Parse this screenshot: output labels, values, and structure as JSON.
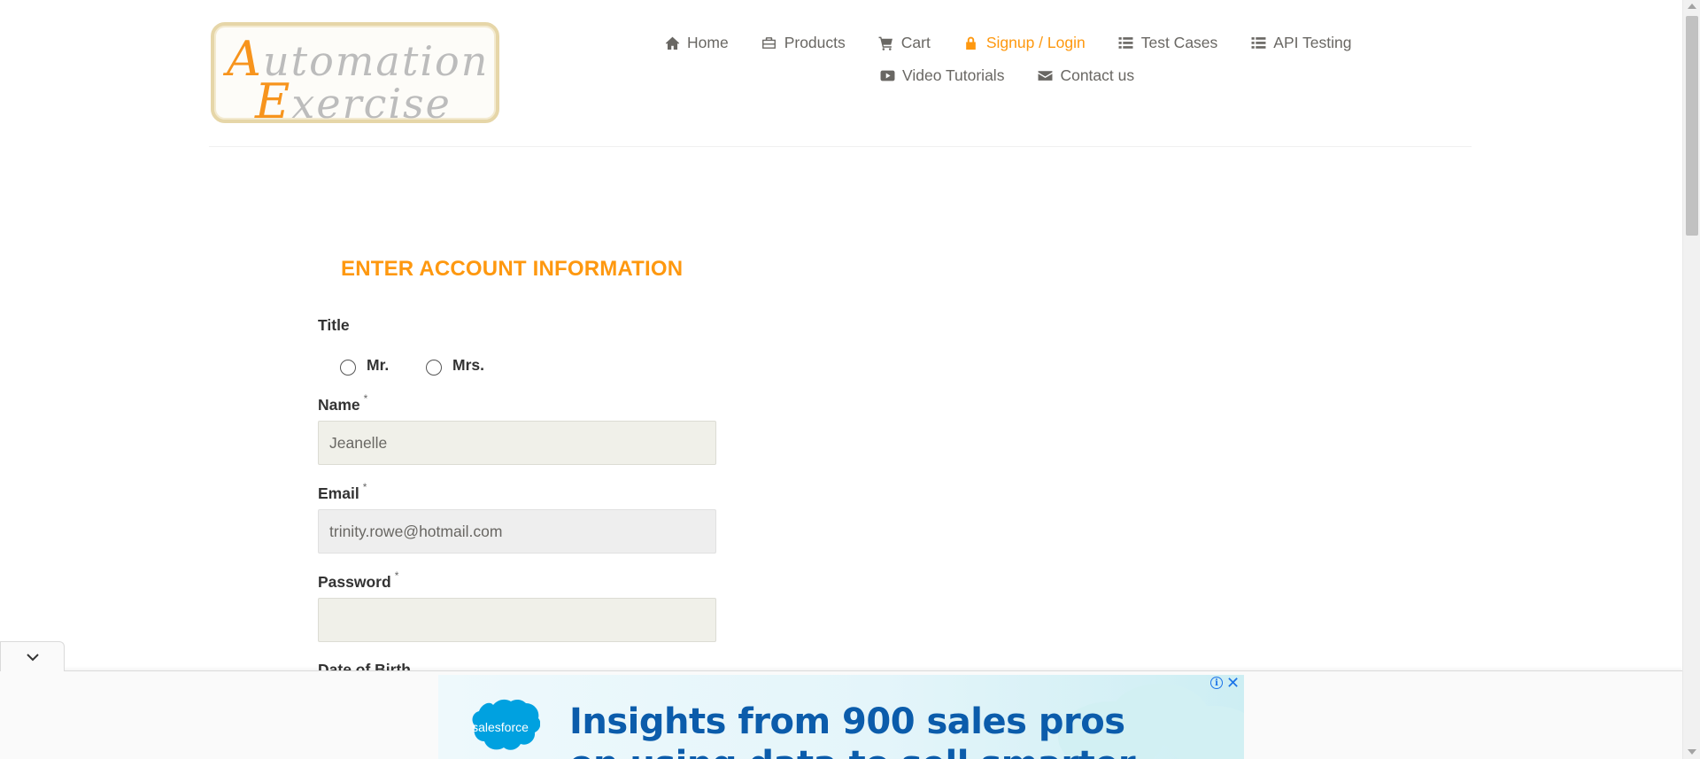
{
  "logo": {
    "line1_cap": "A",
    "line1_rest": "utomation",
    "line2_cap": "E",
    "line2_rest": "xercise"
  },
  "nav": {
    "items": [
      {
        "label": "Home",
        "icon": "home-icon"
      },
      {
        "label": "Products",
        "icon": "briefcase-icon"
      },
      {
        "label": "Cart",
        "icon": "cart-icon"
      },
      {
        "label": "Signup / Login",
        "icon": "lock-icon",
        "active": true
      },
      {
        "label": "Test Cases",
        "icon": "list-icon"
      },
      {
        "label": "API Testing",
        "icon": "list-icon"
      },
      {
        "label": "Video Tutorials",
        "icon": "youtube-play-icon"
      },
      {
        "label": "Contact us",
        "icon": "envelope-icon"
      }
    ],
    "active_color": "#fe980f"
  },
  "form": {
    "heading": "ENTER ACCOUNT INFORMATION",
    "title_label": "Title",
    "title_options": [
      "Mr.",
      "Mrs."
    ],
    "name_label": "Name",
    "name_value": "Jeanelle",
    "email_label": "Email",
    "email_value": "trinity.rowe@hotmail.com",
    "password_label": "Password",
    "password_value": "",
    "dob_label": "Date of Birth",
    "required_mark": "*"
  },
  "ad": {
    "brand": "salesforce",
    "headline": "Insights from 900 sales pros",
    "headline_line2": "on using data to sell smarter",
    "info_icon": "i",
    "close_icon": "✕"
  },
  "colors": {
    "accent": "#fe980f",
    "ad_text": "#0b5cab",
    "salesforce": "#00a1e0"
  }
}
